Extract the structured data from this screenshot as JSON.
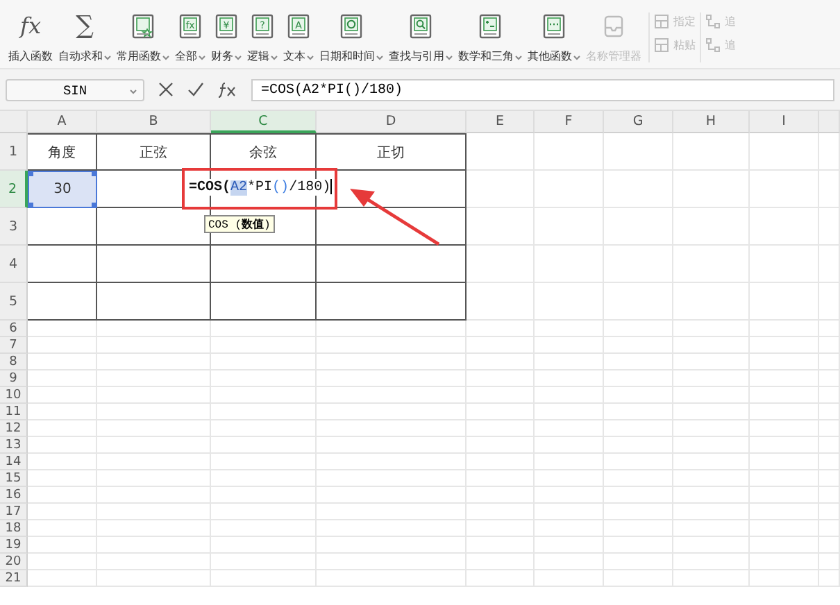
{
  "toolbar": {
    "items": [
      {
        "label": "插入函数",
        "glyph": "fx",
        "dropdown": false,
        "disabled": false
      },
      {
        "label": "自动求和",
        "glyph": "∑",
        "dropdown": true,
        "disabled": false
      },
      {
        "label": "常用函数",
        "dropdown": true,
        "disabled": false
      },
      {
        "label": "全部",
        "glyph": "fx",
        "dropdown": true,
        "disabled": false
      },
      {
        "label": "财务",
        "glyph": "¥",
        "dropdown": true,
        "disabled": false
      },
      {
        "label": "逻辑",
        "glyph": "?",
        "dropdown": true,
        "disabled": false
      },
      {
        "label": "文本",
        "glyph": "A",
        "dropdown": true,
        "disabled": false
      },
      {
        "label": "日期和时间",
        "dropdown": true,
        "disabled": false
      },
      {
        "label": "查找与引用",
        "dropdown": true,
        "disabled": false
      },
      {
        "label": "数学和三角",
        "dropdown": true,
        "disabled": false
      },
      {
        "label": "其他函数",
        "dropdown": true,
        "disabled": false
      },
      {
        "label": "名称管理器",
        "dropdown": false,
        "disabled": true
      }
    ],
    "small": [
      {
        "label": "指定",
        "disabled": true
      },
      {
        "label": "粘贴",
        "disabled": true
      }
    ],
    "trace": [
      {
        "label": "追",
        "disabled": true
      },
      {
        "label": "追",
        "disabled": true
      }
    ]
  },
  "formula_bar": {
    "name_box": "SIN",
    "formula": "=COS(A2*PI()/180)"
  },
  "columns": [
    {
      "label": "A",
      "selected": false
    },
    {
      "label": "B",
      "selected": false
    },
    {
      "label": "C",
      "selected": true
    },
    {
      "label": "D",
      "selected": false
    },
    {
      "label": "E",
      "selected": false
    },
    {
      "label": "F",
      "selected": false
    },
    {
      "label": "G",
      "selected": false
    },
    {
      "label": "H",
      "selected": false
    },
    {
      "label": "I",
      "selected": false
    }
  ],
  "rows": [
    {
      "label": "1",
      "kind": "table",
      "selected": false,
      "cells": [
        {
          "text": "角度",
          "selected": false
        },
        {
          "text": "正弦",
          "selected": false
        },
        {
          "text": "余弦",
          "selected": false
        },
        {
          "text": "正切",
          "selected": false
        }
      ]
    },
    {
      "label": "2",
      "kind": "table",
      "selected": true,
      "cells": [
        {
          "text": "30",
          "selected": true
        },
        {
          "selected": false
        },
        {
          "selected": false
        },
        {
          "selected": false
        }
      ]
    },
    {
      "label": "3",
      "kind": "table",
      "selected": false,
      "cells": [
        {
          "selected": false
        },
        {
          "selected": false
        },
        {
          "selected": false
        },
        {
          "selected": false
        }
      ]
    },
    {
      "label": "4",
      "kind": "table",
      "selected": false,
      "cells": [
        {
          "selected": false
        },
        {
          "selected": false
        },
        {
          "selected": false
        },
        {
          "selected": false
        }
      ]
    },
    {
      "label": "5",
      "kind": "table",
      "selected": false,
      "cells": [
        {
          "selected": false
        },
        {
          "selected": false
        },
        {
          "selected": false
        },
        {
          "selected": false
        }
      ]
    },
    {
      "label": "6",
      "kind": "blank",
      "selected": false
    },
    {
      "label": "7",
      "kind": "blank",
      "selected": false
    },
    {
      "label": "8",
      "kind": "blank",
      "selected": false
    },
    {
      "label": "9",
      "kind": "blank",
      "selected": false
    },
    {
      "label": "10",
      "kind": "blank",
      "selected": false
    },
    {
      "label": "11",
      "kind": "blank",
      "selected": false
    },
    {
      "label": "12",
      "kind": "blank",
      "selected": false
    },
    {
      "label": "13",
      "kind": "blank",
      "selected": false
    },
    {
      "label": "14",
      "kind": "blank",
      "selected": false
    },
    {
      "label": "15",
      "kind": "blank",
      "selected": false
    },
    {
      "label": "16",
      "kind": "blank",
      "selected": false
    },
    {
      "label": "17",
      "kind": "blank",
      "selected": false
    },
    {
      "label": "18",
      "kind": "blank",
      "selected": false
    },
    {
      "label": "19",
      "kind": "blank",
      "selected": false
    },
    {
      "label": "20",
      "kind": "blank",
      "selected": false
    },
    {
      "label": "21",
      "kind": "blank",
      "selected": false
    }
  ],
  "editor": {
    "segments": [
      {
        "text": "=COS(",
        "kind": "func"
      },
      {
        "text": "A2",
        "kind": "ref"
      },
      {
        "text": "*PI",
        "kind": "plain"
      },
      {
        "text": "()",
        "kind": "paren"
      },
      {
        "text": "/180)",
        "kind": "plain"
      }
    ],
    "tooltip": "COS (**数值**)"
  }
}
